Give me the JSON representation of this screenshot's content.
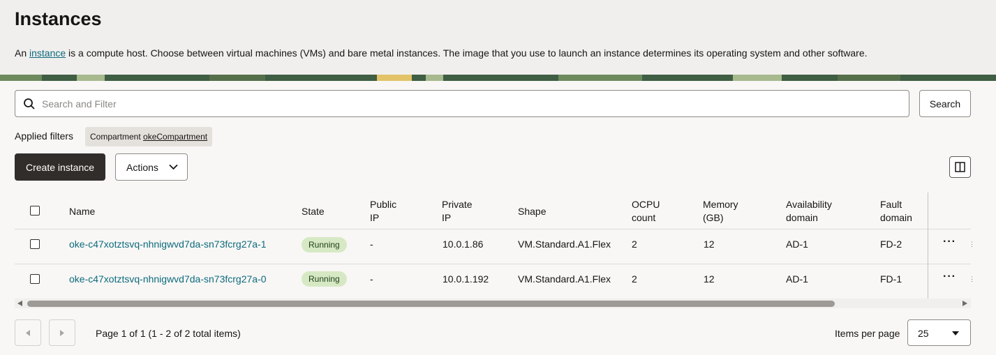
{
  "header": {
    "title": "Instances",
    "desc_prefix": "An ",
    "desc_link": "instance",
    "desc_suffix": " is a compute host. Choose between virtual machines (VMs) and bare metal instances. The image that you use to launch an instance determines its operating system and other software."
  },
  "search": {
    "placeholder": "Search and Filter",
    "button_label": "Search"
  },
  "filters": {
    "label": "Applied filters",
    "chip_key": "Compartment",
    "chip_value": "okeCompartment"
  },
  "toolbar": {
    "create_label": "Create instance",
    "actions_label": "Actions"
  },
  "table": {
    "columns": [
      {
        "l1": "Name",
        "l2": ""
      },
      {
        "l1": "State",
        "l2": ""
      },
      {
        "l1": "Public",
        "l2": "IP"
      },
      {
        "l1": "Private",
        "l2": "IP"
      },
      {
        "l1": "Shape",
        "l2": ""
      },
      {
        "l1": "OCPU",
        "l2": "count"
      },
      {
        "l1": "Memory",
        "l2": "(GB)"
      },
      {
        "l1": "Availability",
        "l2": "domain"
      },
      {
        "l1": "Fault",
        "l2": "domain"
      }
    ],
    "rows": [
      {
        "name": "oke-c47xotztsvq-nhnigwvd7da-sn73fcrg27a-1",
        "state": "Running",
        "public_ip": "-",
        "private_ip": "10.0.1.86",
        "shape": "VM.Standard.A1.Flex",
        "ocpu": "2",
        "memory": "12",
        "ad": "AD-1",
        "fd": "FD-2",
        "kebab": "···"
      },
      {
        "name": "oke-c47xotztsvq-nhnigwvd7da-sn73fcrg27a-0",
        "state": "Running",
        "public_ip": "-",
        "private_ip": "10.0.1.192",
        "shape": "VM.Standard.A1.Flex",
        "ocpu": "2",
        "memory": "12",
        "ad": "AD-1",
        "fd": "FD-1",
        "kebab": "···"
      }
    ]
  },
  "pagination": {
    "info": "Page 1 of 1 (1 - 2 of 2 total items)",
    "items_per_page_label": "Items per page",
    "items_per_page_value": "25"
  },
  "colors": {
    "link": "#0d6a7e",
    "primary_button": "#312d2a",
    "running_badge": "#d6e9c4",
    "banner": "#3f5e43"
  }
}
